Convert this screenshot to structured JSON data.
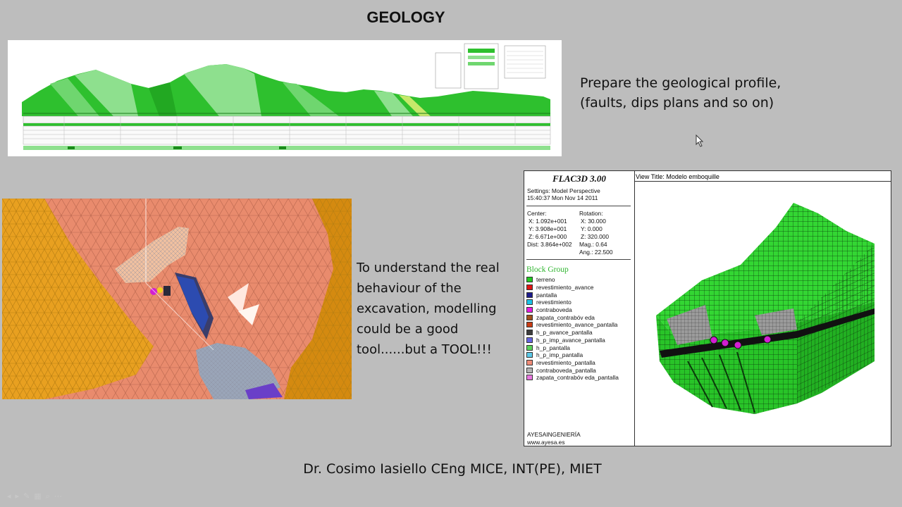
{
  "slide": {
    "title": "GEOLOGY",
    "geology_text": [
      "Prepare the geological profile,",
      "(faults, dips plans and so on)"
    ],
    "modelling_text": [
      "To understand the real",
      "behaviour of the",
      "excavation, modelling",
      "could be a good",
      "tool......but a TOOL!!!"
    ],
    "footer": "Dr. Cosimo Iasiello CEng MICE, INT(PE), MIET"
  },
  "flac": {
    "title": "FLAC3D 3.00",
    "settings": "Settings:  Model Perspective",
    "timestamp": "15:40:37 Mon Nov 14 2011",
    "center_label": "Center:",
    "center_x": "X: 1.092e+001",
    "center_y": "Y: 3.908e+001",
    "center_z": "Z: 6.671e+000",
    "dist": "Dist: 3.864e+002",
    "rotation_label": "Rotation:",
    "rot_x": "X:  30.000",
    "rot_y": "Y:   0.000",
    "rot_z": "Z: 320.000",
    "mag": "Mag.:      0.64",
    "ang": "Ang.:   22.500",
    "block_group_title": "Block Group",
    "legend": [
      {
        "label": "terreno",
        "color": "#22c922"
      },
      {
        "label": "revestimiento_avance",
        "color": "#e01414"
      },
      {
        "label": "pantalla",
        "color": "#1c1c8c"
      },
      {
        "label": "revestimiento",
        "color": "#1cc3e8"
      },
      {
        "label": "contraboveda",
        "color": "#e81ce0"
      },
      {
        "label": "zapata_contrabóv eda",
        "color": "#a0521c"
      },
      {
        "label": "revestimiento_avance_pantalla",
        "color": "#c83c14"
      },
      {
        "label": "h_p_avance_pantalla",
        "color": "#3c3c3c"
      },
      {
        "label": "h_p_imp_avance_pantalla",
        "color": "#6464e0"
      },
      {
        "label": "h_p_pantalla",
        "color": "#5ad25a"
      },
      {
        "label": "h_p_imp_pantalla",
        "color": "#5ac8e8"
      },
      {
        "label": "revestimiento_pantalla",
        "color": "#f08c78"
      },
      {
        "label": "contraboveda_pantalla",
        "color": "#b4b4b4"
      },
      {
        "label": "zapata_contrabóv eda_pantalla",
        "color": "#e878e0"
      }
    ],
    "company": "AYESAINGENIERÍA",
    "website": "www.ayesa.es",
    "view_title": "View Title: Modelo emboquille"
  }
}
